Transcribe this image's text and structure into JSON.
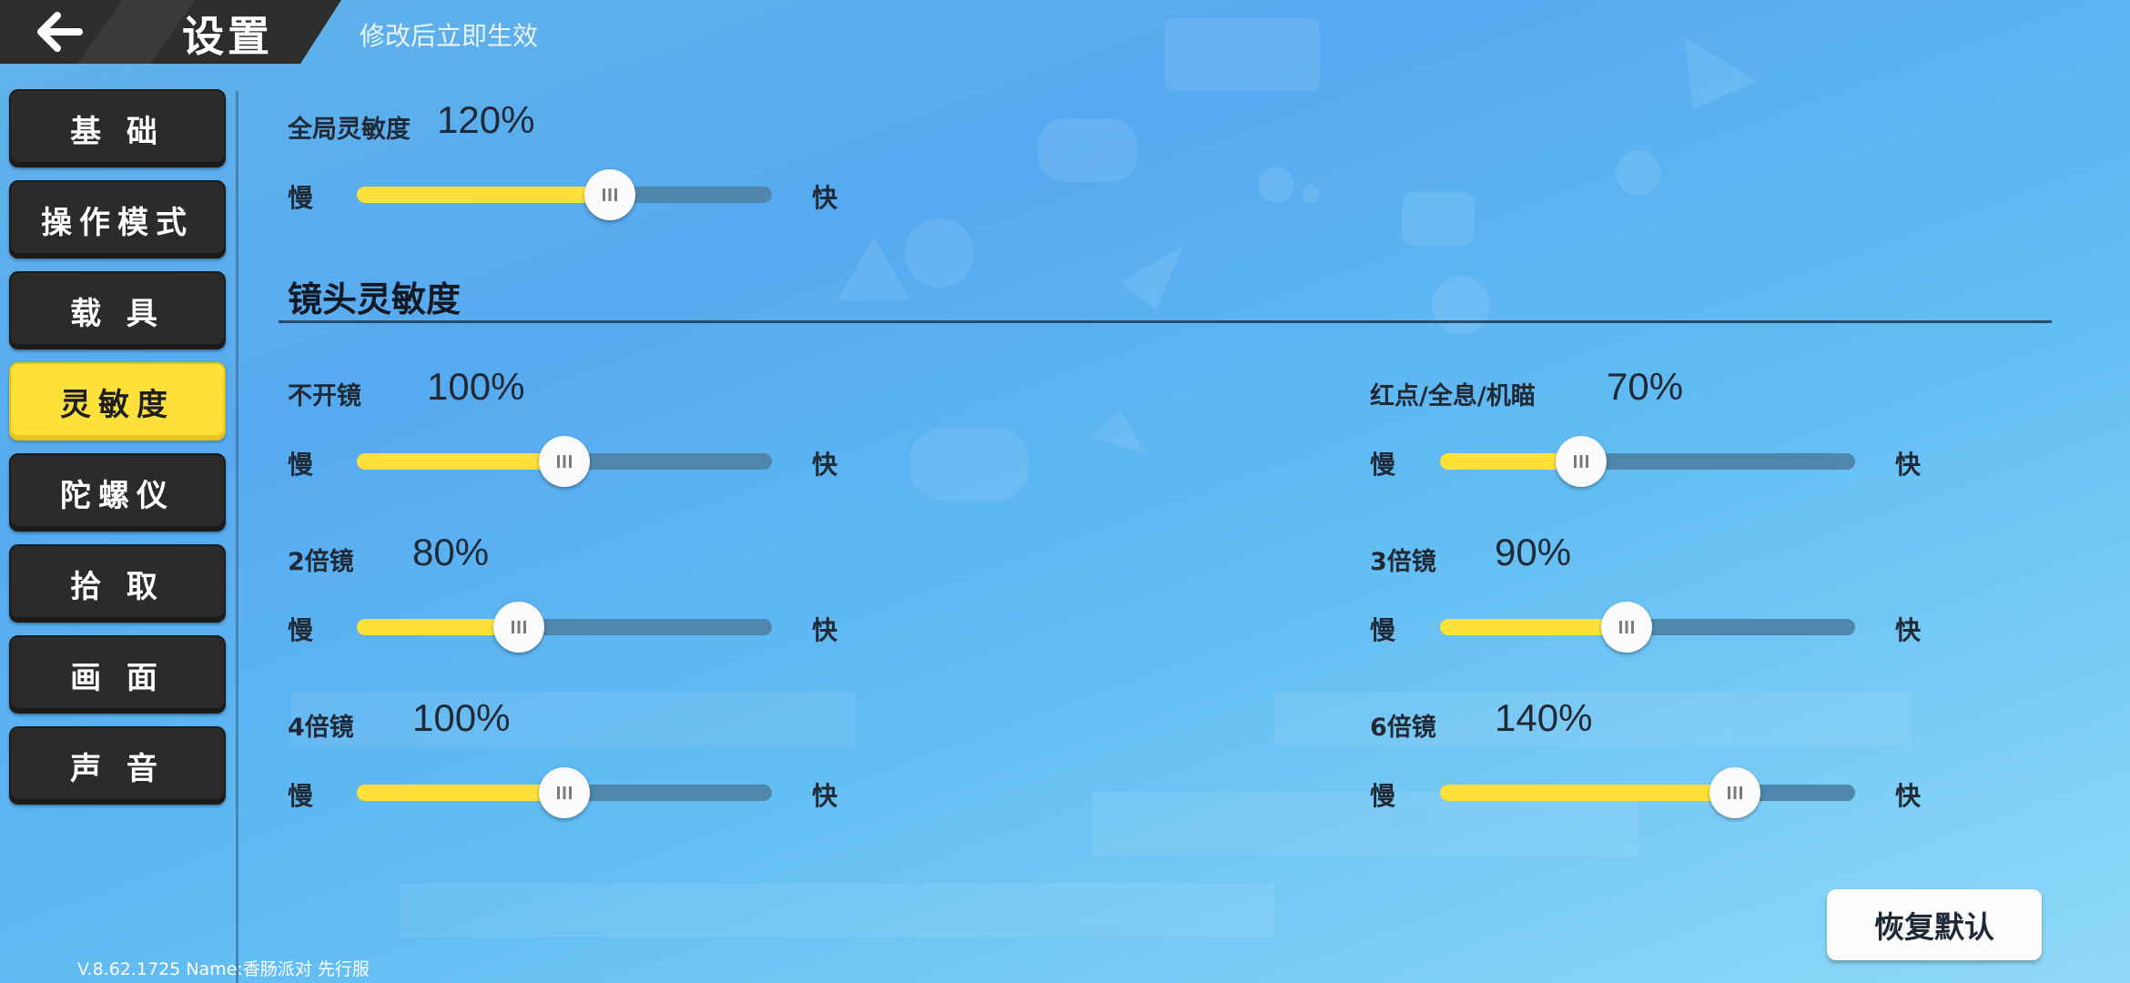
{
  "header": {
    "back_icon": "arrow-left-icon",
    "title": "设置",
    "subtitle": "修改后立即生效"
  },
  "sidebar": {
    "items": [
      {
        "label": "基 础",
        "active": false
      },
      {
        "label": "操作模式",
        "active": false
      },
      {
        "label": "载 具",
        "active": false
      },
      {
        "label": "灵敏度",
        "active": true
      },
      {
        "label": "陀螺仪",
        "active": false
      },
      {
        "label": "拾 取",
        "active": false
      },
      {
        "label": "画 面",
        "active": false
      },
      {
        "label": "声 音",
        "active": false
      }
    ]
  },
  "global": {
    "label": "全局灵敏度",
    "value": "120%",
    "level": 0.61,
    "slow": "慢",
    "fast": "快"
  },
  "camera_section": {
    "title": "镜头灵敏度",
    "settings": [
      {
        "label": "不开镜",
        "value": "100%",
        "level": 0.5,
        "slow": "慢",
        "fast": "快"
      },
      {
        "label": "红点/全息/机瞄",
        "value": "70%",
        "level": 0.34,
        "slow": "慢",
        "fast": "快"
      },
      {
        "label": "2倍镜",
        "value": "80%",
        "level": 0.39,
        "slow": "慢",
        "fast": "快"
      },
      {
        "label": "3倍镜",
        "value": "90%",
        "level": 0.45,
        "slow": "慢",
        "fast": "快"
      },
      {
        "label": "4倍镜",
        "value": "100%",
        "level": 0.5,
        "slow": "慢",
        "fast": "快"
      },
      {
        "label": "6倍镜",
        "value": "140%",
        "level": 0.71,
        "slow": "慢",
        "fast": "快"
      }
    ]
  },
  "reset_label": "恢复默认",
  "version_text": "V.8.62.1725 Name:香肠派对 先行服",
  "colors": {
    "accent": "#fde13a",
    "track": "#4e86ac",
    "sidebar_bg": "#2b2b2b",
    "text_dark": "#1f2a36"
  }
}
